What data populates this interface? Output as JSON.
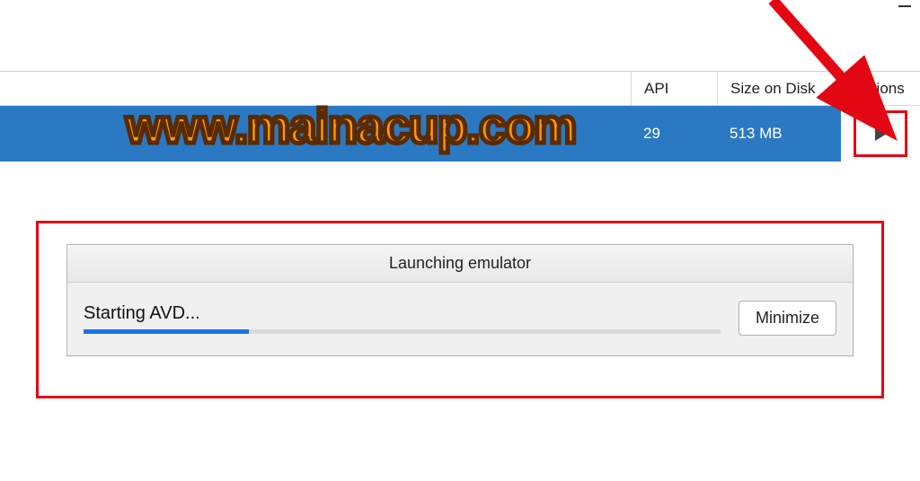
{
  "window": {
    "minimize_glyph": "—"
  },
  "headers": {
    "api": "API",
    "size": "Size on Disk",
    "actions": "Actions"
  },
  "row": {
    "api": "29",
    "size": "513 MB",
    "play_icon": "play"
  },
  "dialog": {
    "title": "Launching emulator",
    "status": "Starting AVD...",
    "progress_percent": 26,
    "minimize_label": "Minimize"
  },
  "watermark": "www.mainacup.com",
  "annotations": {
    "arrow_color": "#e30613",
    "highlight_color": "#e30613"
  }
}
